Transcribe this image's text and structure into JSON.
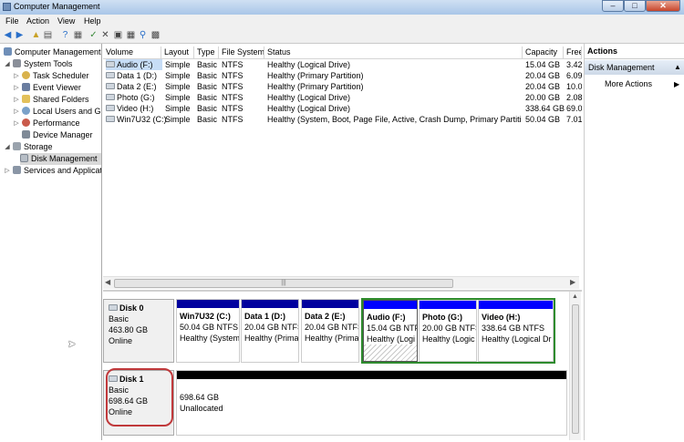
{
  "window": {
    "title": "Computer Management",
    "min": "–",
    "max": "□",
    "close": "✕"
  },
  "menu": [
    "File",
    "Action",
    "View",
    "Help"
  ],
  "tree": [
    {
      "label": "Computer Management",
      "icon": "computer-management-icon"
    },
    {
      "label": "System Tools",
      "icon": "system-tools-icon"
    },
    {
      "label": "Task Scheduler",
      "icon": "task-scheduler-icon"
    },
    {
      "label": "Event Viewer",
      "icon": "event-viewer-icon"
    },
    {
      "label": "Shared Folders",
      "icon": "shared-folders-icon"
    },
    {
      "label": "Local Users and Gr",
      "icon": "local-users-icon"
    },
    {
      "label": "Performance",
      "icon": "performance-icon"
    },
    {
      "label": "Device Manager",
      "icon": "device-manager-icon"
    },
    {
      "label": "Storage",
      "icon": "storage-icon"
    },
    {
      "label": "Disk Management",
      "icon": "disk-management-icon"
    },
    {
      "label": "Services and Applicat",
      "icon": "services-icon"
    }
  ],
  "columns": [
    "Volume",
    "Layout",
    "Type",
    "File System",
    "Status",
    "Capacity",
    "Free"
  ],
  "volumes": [
    {
      "name": "Audio (F:)",
      "layout": "Simple",
      "type": "Basic",
      "fs": "NTFS",
      "status": "Healthy (Logical Drive)",
      "capacity": "15.04 GB",
      "free": "3.42"
    },
    {
      "name": "Data 1 (D:)",
      "layout": "Simple",
      "type": "Basic",
      "fs": "NTFS",
      "status": "Healthy (Primary Partition)",
      "capacity": "20.04 GB",
      "free": "6.09"
    },
    {
      "name": "Data 2 (E:)",
      "layout": "Simple",
      "type": "Basic",
      "fs": "NTFS",
      "status": "Healthy (Primary Partition)",
      "capacity": "20.04 GB",
      "free": "10.0"
    },
    {
      "name": "Photo (G:)",
      "layout": "Simple",
      "type": "Basic",
      "fs": "NTFS",
      "status": "Healthy (Logical Drive)",
      "capacity": "20.00 GB",
      "free": "2.08"
    },
    {
      "name": "Video (H:)",
      "layout": "Simple",
      "type": "Basic",
      "fs": "NTFS",
      "status": "Healthy (Logical Drive)",
      "capacity": "338.64 GB",
      "free": "69.0"
    },
    {
      "name": "Win7U32 (C:)",
      "layout": "Simple",
      "type": "Basic",
      "fs": "NTFS",
      "status": "Healthy (System, Boot, Page File, Active, Crash Dump, Primary Partition)",
      "capacity": "50.04 GB",
      "free": "7.01"
    }
  ],
  "disks": [
    {
      "name": "Disk 0",
      "type": "Basic",
      "size": "463.80 GB",
      "state": "Online",
      "partitions": [
        {
          "title": "Win7U32  (C:)",
          "size": "50.04 GB NTFS",
          "status": "Healthy (System"
        },
        {
          "title": "Data 1  (D:)",
          "size": "20.04 GB NTFS",
          "status": "Healthy (Prima"
        },
        {
          "title": "Data 2  (E:)",
          "size": "20.04 GB NTFS",
          "status": "Healthy (Prima"
        },
        {
          "title": "Audio  (F:)",
          "size": "15.04 GB NTF",
          "status": "Healthy (Logi"
        },
        {
          "title": "Photo  (G:)",
          "size": "20.00 GB NTFS",
          "status": "Healthy (Logic"
        },
        {
          "title": "Video  (H:)",
          "size": "338.64 GB NTFS",
          "status": "Healthy (Logical Dr"
        }
      ]
    },
    {
      "name": "Disk 1",
      "type": "Basic",
      "size": "698.64 GB",
      "state": "Online",
      "partitions": [
        {
          "size": "698.64 GB",
          "status": "Unallocated"
        }
      ]
    }
  ],
  "actions": {
    "title": "Actions",
    "section": "Disk Management",
    "more": "More Actions"
  },
  "colors": {
    "primary": "#00009e",
    "logical": "#0000ff",
    "unallocated": "#000000",
    "extended": "#2e8b2e",
    "highlight": "#c0393b"
  }
}
